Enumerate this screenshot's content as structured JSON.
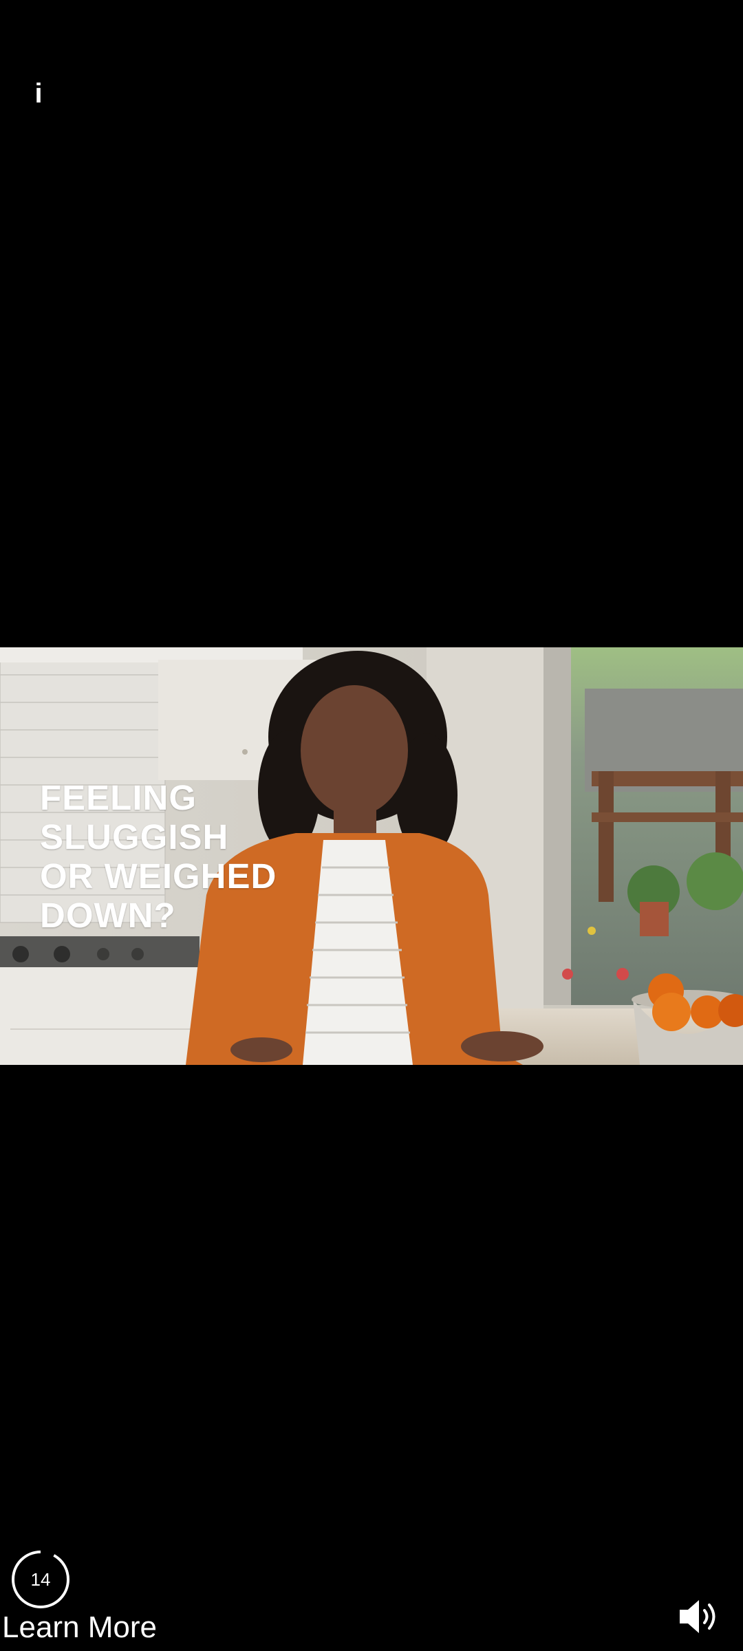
{
  "ad_overlay": {
    "info_label": "i",
    "countdown_seconds": "14",
    "countdown_progress": 0.08,
    "cta_label": "Learn More"
  },
  "video": {
    "caption": "FEELING\nSLUGGISH\nOR WEIGHED\nDOWN?"
  },
  "icons": {
    "info": "info-icon",
    "countdown": "countdown-ring",
    "volume": "volume-on-icon"
  },
  "colors": {
    "background": "#000000",
    "text": "#ffffff",
    "cardigan_orange": "#d2691e"
  }
}
